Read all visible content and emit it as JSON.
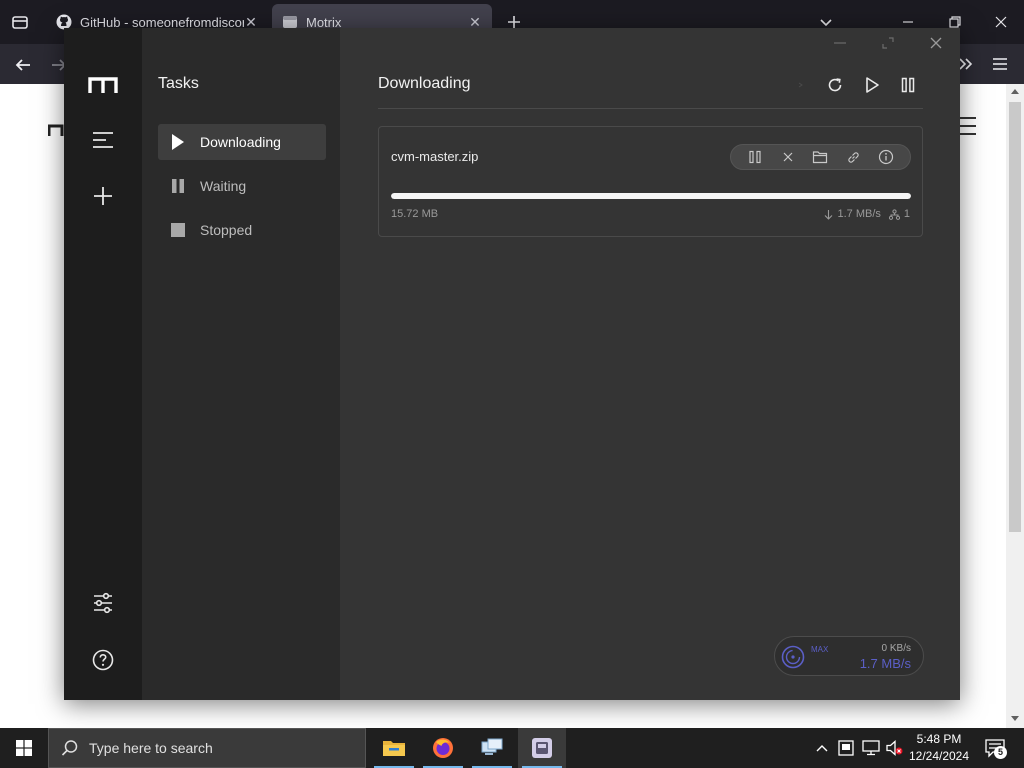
{
  "browser": {
    "tabs": [
      {
        "label": "GitHub - someonefromdiscord",
        "icon": "github-icon",
        "active": false
      },
      {
        "label": "Motrix",
        "icon": "motrix-favicon",
        "active": true
      }
    ]
  },
  "motrix": {
    "subnav": {
      "title": "Tasks",
      "items": [
        {
          "label": "Downloading",
          "icon": "play-icon",
          "active": true
        },
        {
          "label": "Waiting",
          "icon": "pause-icon",
          "active": false
        },
        {
          "label": "Stopped",
          "icon": "stop-icon",
          "active": false
        }
      ]
    },
    "main": {
      "title": "Downloading",
      "toolbar": [
        "refresh-icon",
        "resume-all-icon",
        "pause-all-icon"
      ]
    },
    "task": {
      "name": "cvm-master.zip",
      "size": "15.72 MB",
      "speed": "1.7 MB/s",
      "connections": "1",
      "progress": 1.0
    },
    "speedometer": {
      "mode": "MAX",
      "upload": "0 KB/s",
      "download": "1.7 MB/s"
    },
    "colors": {
      "accent": "#5b5fc7",
      "nav_bg": "#1d1d1d",
      "subnav_bg": "#2a2a2a",
      "main_bg": "#343434"
    }
  },
  "taskbar": {
    "search_placeholder": "Type here to search",
    "time": "5:48 PM",
    "date": "12/24/2024",
    "notification_count": "5"
  }
}
